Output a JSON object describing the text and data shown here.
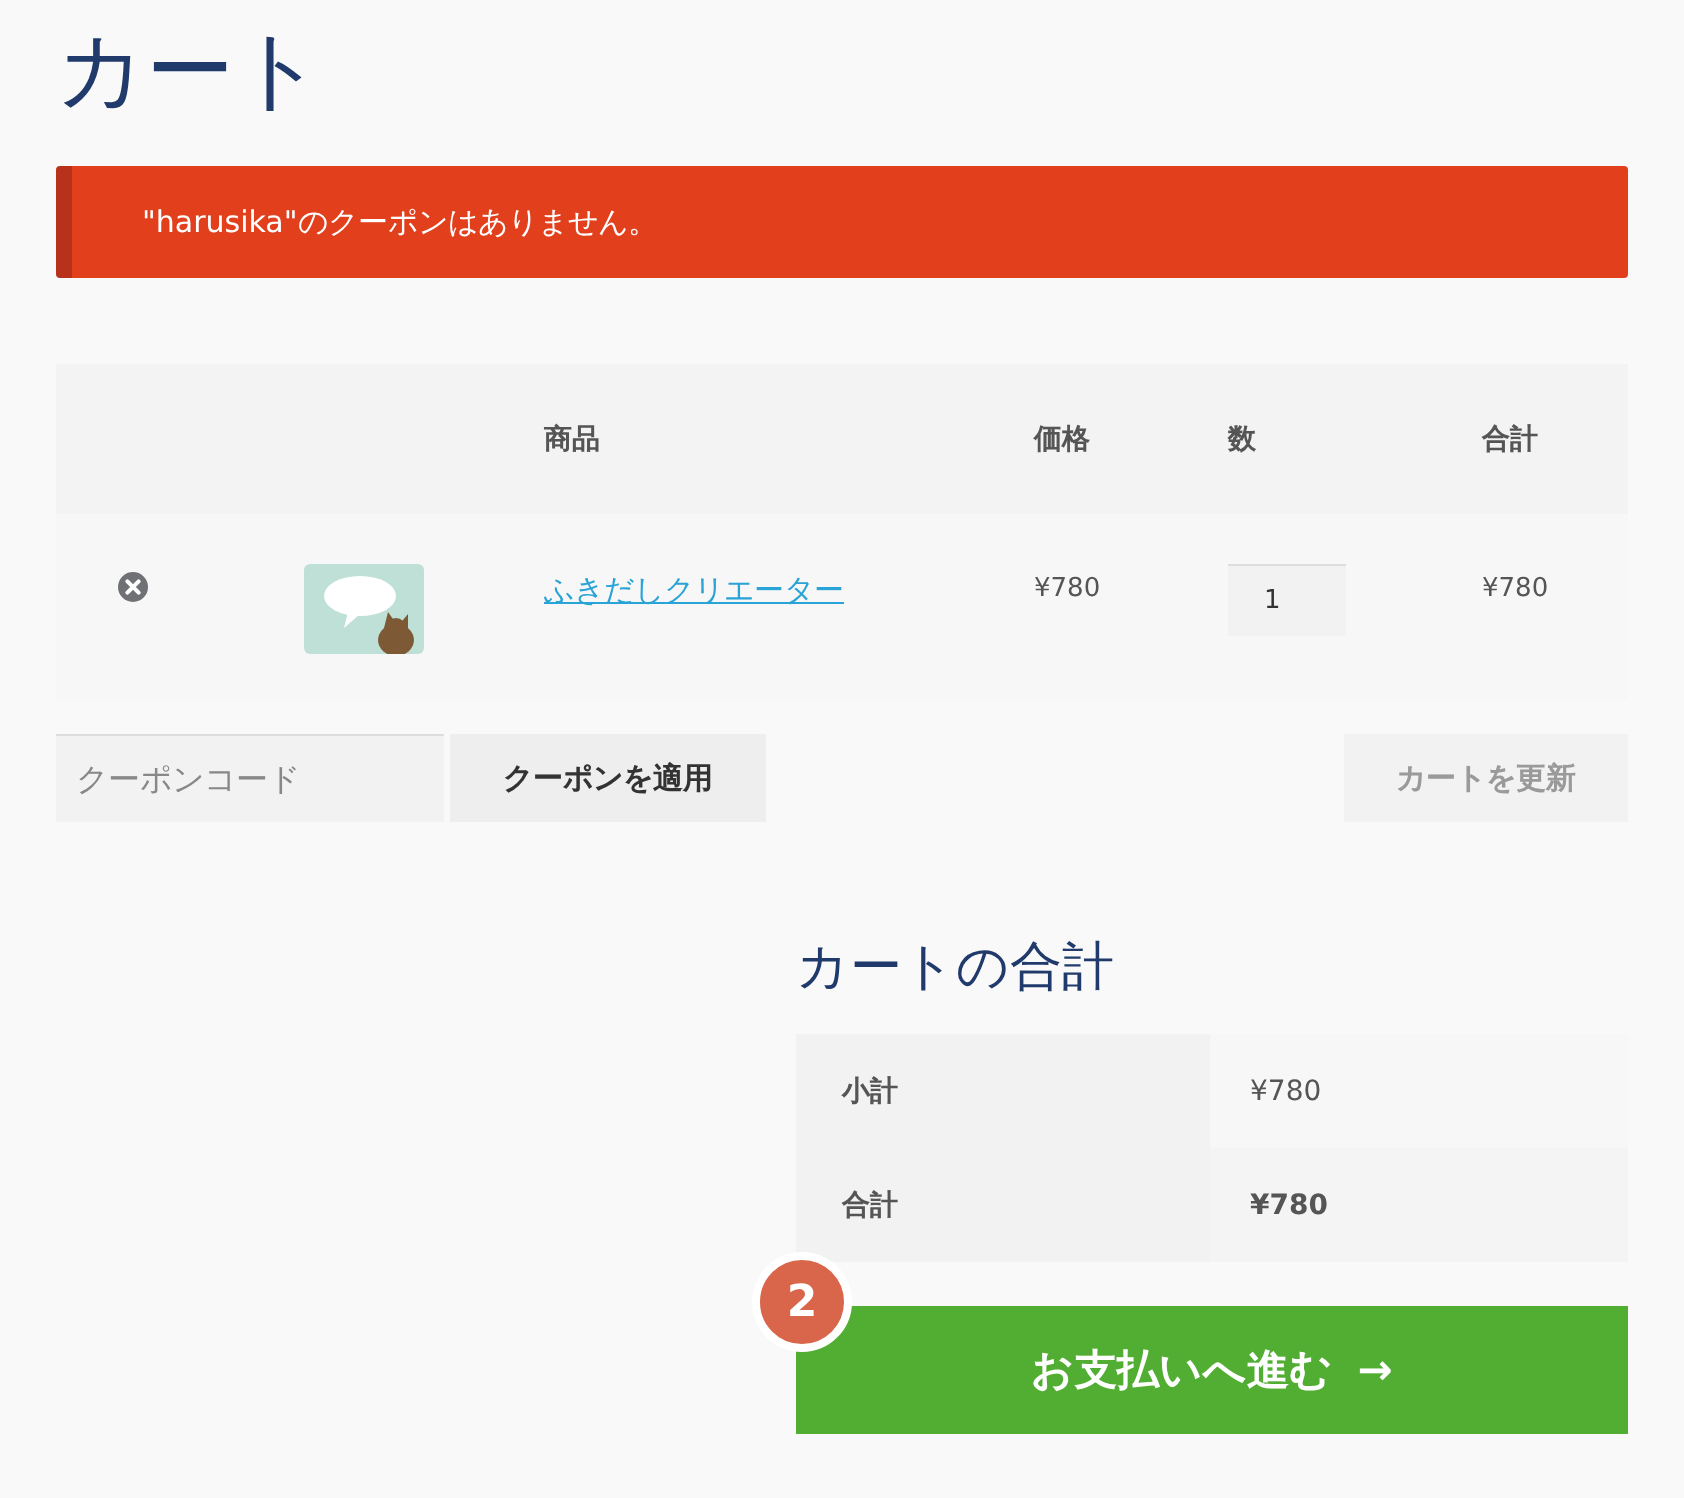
{
  "page_title": "カート",
  "notice": {
    "kind": "error",
    "text": "\"harusika\"のクーポンはありません。"
  },
  "cart_table": {
    "columns": [
      "商品",
      "価格",
      "数",
      "合計"
    ],
    "rows": [
      {
        "product": "ふきだしクリエーター",
        "price": "¥780",
        "quantity": "1",
        "total": "¥780"
      }
    ]
  },
  "coupon": {
    "placeholder": "クーポンコード",
    "apply_button": "クーポンを適用",
    "update_button": "カートを更新",
    "update_disabled": true
  },
  "totals": {
    "title": "カートの合計",
    "rows": [
      {
        "kind": "subtotal",
        "label": "小計",
        "value": "¥780"
      },
      {
        "kind": "total",
        "label": "合計",
        "value": "¥780"
      }
    ]
  },
  "checkout": {
    "label": "お支払いへ進む",
    "arrow": "→",
    "step_badge": "2"
  }
}
